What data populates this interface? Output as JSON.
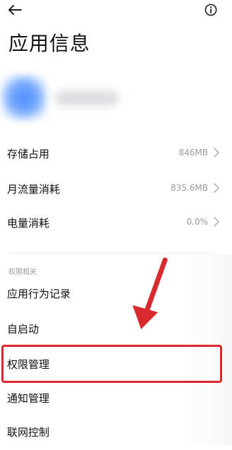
{
  "header": {
    "back_icon": "arrow-left-icon",
    "info_icon": "info-circle-icon",
    "title": "应用信息"
  },
  "stats": [
    {
      "label": "存储占用",
      "value": "846MB"
    },
    {
      "label": "月流量消耗",
      "value": "835.6MB"
    },
    {
      "label": "电量消耗",
      "value": "0.0%"
    }
  ],
  "permissions_section": {
    "label": "权限相关",
    "items": [
      {
        "label": "应用行为记录"
      },
      {
        "label": "自启动"
      },
      {
        "label": "权限管理"
      },
      {
        "label": "通知管理"
      },
      {
        "label": "联网控制"
      }
    ]
  },
  "colors": {
    "highlight": "#d9282e",
    "arrow": "#d9282e"
  }
}
